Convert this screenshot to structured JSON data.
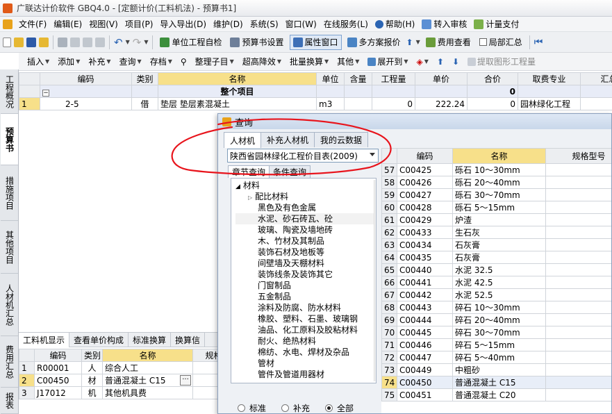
{
  "window": {
    "title": "广联达计价软件 GBQ4.0 - [定额计价(工料机法) - 预算书1]"
  },
  "menu": [
    "文件(F)",
    "编辑(E)",
    "视图(V)",
    "项目(P)",
    "导入导出(D)",
    "维护(D)",
    "系统(S)",
    "窗口(W)",
    "在线服务(L)",
    "帮助(H)",
    "转入审核",
    "计量支付"
  ],
  "toolbar1": {
    "self_check": "单位工程自检",
    "budget_settings": "预算书设置",
    "property_window": "属性窗口",
    "multi_plan": "多方案报价",
    "fee_view": "费用查看",
    "partial_summary": "局部汇总"
  },
  "toolbar2": [
    "插入",
    "添加",
    "补充",
    "查询",
    "存档",
    "整理子目",
    "超高降效",
    "批量换算",
    "其他",
    "展开到",
    "提取图形工程量"
  ],
  "vtabs": [
    "工程概况",
    "预算书",
    "措施项目",
    "其他项目",
    "人材机汇总",
    "费用汇总",
    "报表"
  ],
  "main_grid": {
    "headers": [
      "",
      "编码",
      "类别",
      "名称",
      "单位",
      "含量",
      "工程量",
      "单价",
      "合价",
      "取费专业",
      "汇总"
    ],
    "group_row": {
      "name": "整个项目",
      "total": "0"
    },
    "rows": [
      {
        "num": "1",
        "code": "2-5",
        "type": "借",
        "name": "垫层 垫层素混凝土",
        "unit": "m3",
        "qty": "0",
        "price": "222.24",
        "total": "0",
        "fee": "园林绿化工程"
      }
    ]
  },
  "bottom_tabs": [
    "工料机显示",
    "查看单价构成",
    "标准换算",
    "换算信"
  ],
  "bottom_grid": {
    "headers": [
      "",
      "编码",
      "类别",
      "名称",
      "规格"
    ],
    "rows": [
      {
        "num": "1",
        "code": "R00001",
        "type": "人",
        "name": "综合人工"
      },
      {
        "num": "2",
        "code": "C00450",
        "type": "材",
        "name": "普通混凝土 C15"
      },
      {
        "num": "3",
        "code": "J17012",
        "type": "机",
        "name": "其他机具费"
      }
    ]
  },
  "dialog": {
    "title": "查询",
    "tabs": [
      "人材机",
      "补充人材机",
      "我的云数据"
    ],
    "library": "陕西省园林绿化工程价目表(2009)",
    "subtabs": [
      "章节查询",
      "条件查询"
    ],
    "tree_root": "材料",
    "tree": [
      "配比材料",
      "黑色及有色金属",
      "水泥、砂石砖瓦、砼",
      "玻璃、陶瓷及墙地砖",
      "木、竹材及其制品",
      "装饰石材及地板等",
      "间壁墙及天棚材料",
      "装饰线条及装饰其它",
      "门窗制品",
      "五金制品",
      "涂料及防腐、防水材料",
      "橡胶、塑料、石墨、玻璃钢",
      "油品、化工原料及胶粘材料",
      "耐火、绝热材料",
      "棉纺、水电、焊材及杂品",
      "管材",
      "管件及管道用器材"
    ],
    "radios": [
      "标准",
      "补充",
      "全部"
    ],
    "grid_headers": [
      "",
      "编码",
      "名称",
      "规格型号"
    ],
    "rows": [
      {
        "num": "57",
        "code": "C00425",
        "name": "砾石 10～30mm"
      },
      {
        "num": "58",
        "code": "C00426",
        "name": "砾石 20～40mm"
      },
      {
        "num": "59",
        "code": "C00427",
        "name": "砾石 30～70mm"
      },
      {
        "num": "60",
        "code": "C00428",
        "name": "砾石 5～15mm"
      },
      {
        "num": "61",
        "code": "C00429",
        "name": "炉渣"
      },
      {
        "num": "62",
        "code": "C00433",
        "name": "生石灰"
      },
      {
        "num": "63",
        "code": "C00434",
        "name": "石灰膏"
      },
      {
        "num": "64",
        "code": "C00435",
        "name": "石灰膏"
      },
      {
        "num": "65",
        "code": "C00440",
        "name": "水泥 32.5"
      },
      {
        "num": "66",
        "code": "C00441",
        "name": "水泥 42.5"
      },
      {
        "num": "67",
        "code": "C00442",
        "name": "水泥 52.5"
      },
      {
        "num": "68",
        "code": "C00443",
        "name": "碎石 10～30mm"
      },
      {
        "num": "69",
        "code": "C00444",
        "name": "碎石 20～40mm"
      },
      {
        "num": "70",
        "code": "C00445",
        "name": "碎石 30～70mm"
      },
      {
        "num": "71",
        "code": "C00446",
        "name": "碎石 5～15mm"
      },
      {
        "num": "72",
        "code": "C00447",
        "name": "碎石 5～40mm"
      },
      {
        "num": "73",
        "code": "C00449",
        "name": "中粗砂"
      },
      {
        "num": "74",
        "code": "C00450",
        "name": "普通混凝土 C15"
      },
      {
        "num": "75",
        "code": "C00451",
        "name": "普通混凝土 C20"
      }
    ]
  },
  "colors": {
    "highlight": "#f7e08a",
    "annotation": "#e8141c",
    "accent": "#2b64b3"
  }
}
